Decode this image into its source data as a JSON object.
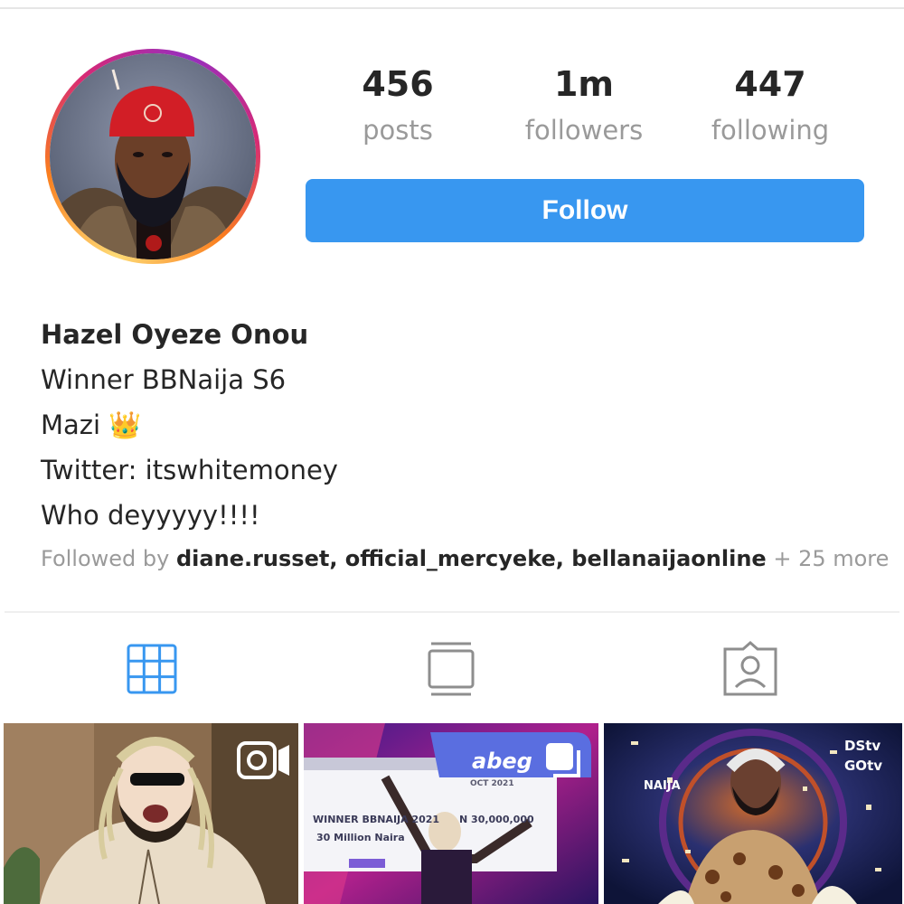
{
  "profile": {
    "stats": [
      {
        "value": "456",
        "label": "posts"
      },
      {
        "value": "1m",
        "label": "followers"
      },
      {
        "value": "447",
        "label": "following"
      }
    ],
    "follow_label": "Follow",
    "name": "Hazel Oyeze Onou",
    "bio_lines": [
      "Winner BBNaija S6",
      "Mazi 👑",
      "Twitter: itswhitemoney",
      "Who deyyyyy!!!!"
    ],
    "followed_by": {
      "prefix": "Followed by",
      "users": "diane.russet, official_mercyeke, bellanaijaonline",
      "more": "+ 25 more"
    }
  },
  "tabs": [
    {
      "name": "grid-icon",
      "active": true
    },
    {
      "name": "igtv-icon",
      "active": false
    },
    {
      "name": "tagged-icon",
      "active": false
    }
  ],
  "posts": [
    {
      "type": "video",
      "badge_icon": "reel-icon"
    },
    {
      "type": "carousel",
      "badge_icon": "carousel-icon",
      "banner_text": "abeg",
      "board_title": "WINNER BBNAIJA 2021",
      "board_sub": "30 Million Naira",
      "board_amount": "N 30,000,000",
      "board_tag": "OCT 2021"
    },
    {
      "type": "image",
      "logo_dstv": "DStv",
      "logo_gotv": "GOtv",
      "show_text": "NAIJA"
    }
  ],
  "colors": {
    "accent": "#3897f0",
    "active_tab": "#3897f0",
    "inactive_tab": "#8e8e8e"
  }
}
